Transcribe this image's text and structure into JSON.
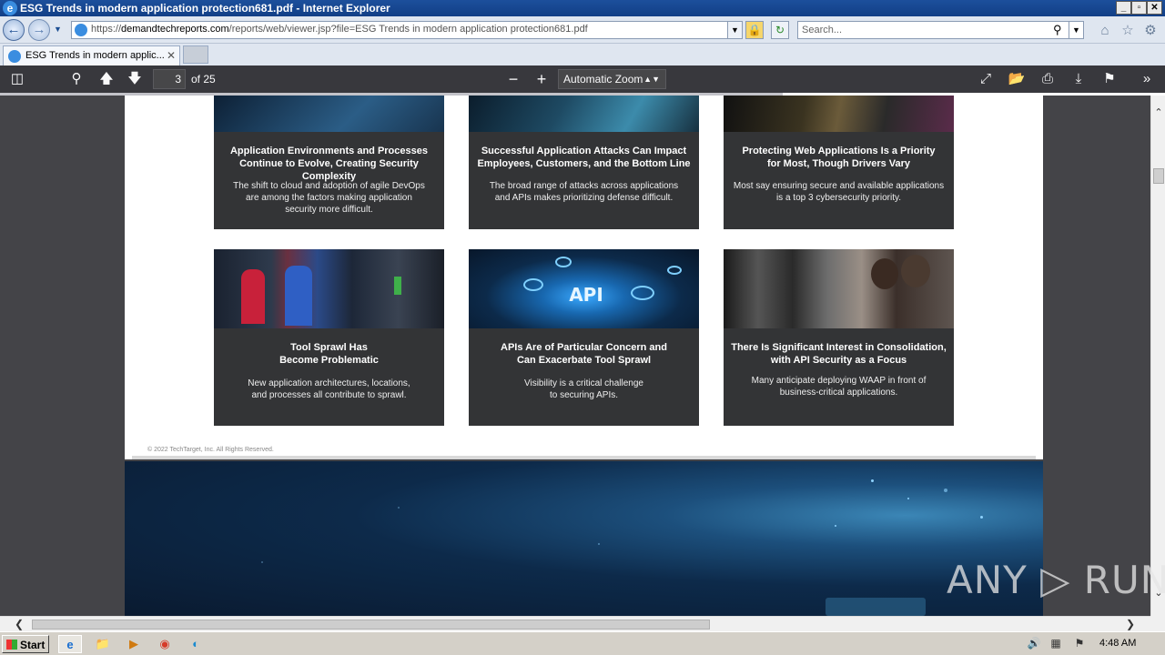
{
  "window": {
    "title": "ESG Trends in modern application protection681.pdf - Internet Explorer",
    "min_label": "_",
    "max_label": "▫",
    "close_label": "✕"
  },
  "nav": {
    "url_prefix": "https://",
    "url_domain": "demandtechreports.com",
    "url_path": "/reports/web/viewer.jsp?file=ESG Trends in modern application protection681.pdf",
    "search_placeholder": "Search..."
  },
  "tab": {
    "label": "ESG Trends in modern applic...",
    "close": "✕"
  },
  "pdf_toolbar": {
    "page_number": "3",
    "page_count": "of 25",
    "zoom": "Automatic Zoom"
  },
  "cards": [
    {
      "title1": "Application Environments and Processes",
      "title2": "Continue to Evolve, Creating Security Complexity",
      "body": [
        "The shift to cloud and adoption of agile DevOps",
        "are among the factors making application",
        "security more difficult."
      ]
    },
    {
      "title1": "Successful Application Attacks Can Impact",
      "title2": "Employees, Customers, and the Bottom Line",
      "body": [
        "The broad range of attacks across applications",
        "and APIs makes prioritizing defense difficult."
      ]
    },
    {
      "title1": "Protecting Web Applications Is a Priority",
      "title2": "for Most, Though Drivers Vary",
      "body": [
        "Most say ensuring secure and available applications",
        "is a top 3 cybersecurity priority."
      ]
    },
    {
      "title1": "Tool Sprawl Has",
      "title2": "Become Problematic",
      "body": [
        "New application architectures, locations,",
        "and processes all contribute to sprawl."
      ]
    },
    {
      "title1": "APIs Are of Particular Concern and",
      "title2": "Can Exacerbate Tool Sprawl",
      "body": [
        "Visibility is a critical challenge",
        "to securing APIs."
      ],
      "img_label": "API"
    },
    {
      "title1": "There Is Significant Interest in Consolidation,",
      "title2": "with API Security as a Focus",
      "body": [
        "Many anticipate deploying WAAP in front of",
        "business-critical applications."
      ]
    }
  ],
  "copyright": "© 2022 TechTarget, Inc. All Rights Reserved.",
  "watermark": "ANY ▷ RUN",
  "taskbar": {
    "start": "Start",
    "time": "4:48 AM"
  },
  "colors": {
    "title_bar": "#1c4f9c",
    "pdf_toolbar": "#38383d",
    "viewer_bg": "#444448",
    "card_bg": "#333436"
  }
}
